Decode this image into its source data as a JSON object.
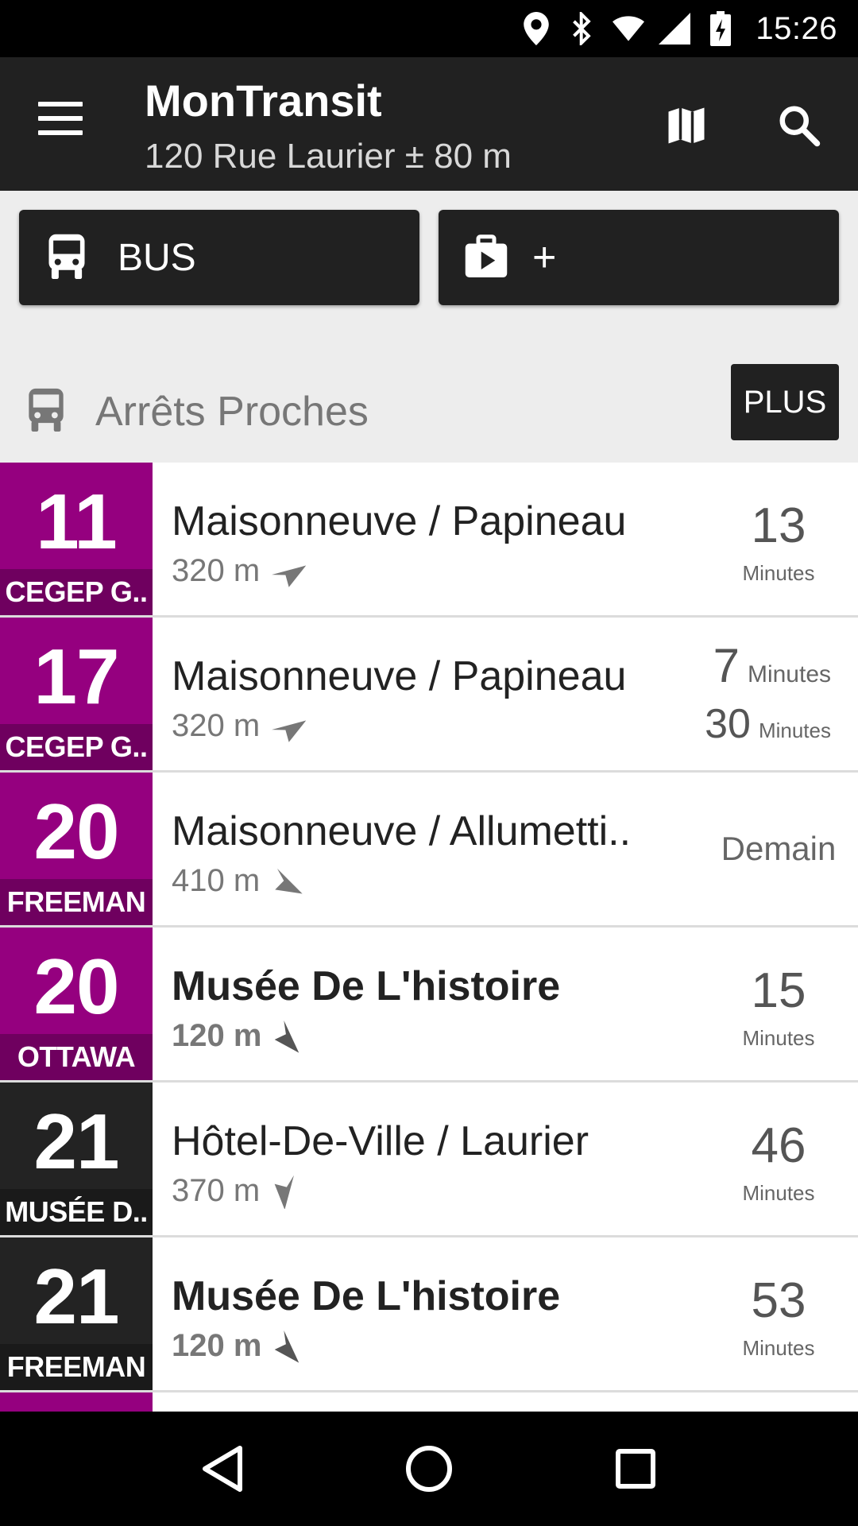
{
  "status_bar": {
    "time": "15:26"
  },
  "app_bar": {
    "title": "MonTransit",
    "subtitle": "120 Rue Laurier ± 80 m"
  },
  "actions": {
    "bus_label": "BUS",
    "add_label": "+"
  },
  "nearby": {
    "title": "Arrêts Proches",
    "more_label": "PLUS"
  },
  "colors": {
    "route_purple": "#95007f",
    "route_dark": "#232323",
    "app_bar": "#212121"
  },
  "stops": [
    {
      "route": "11",
      "headsign": "CEGEP G..",
      "color": "#95007f",
      "name": "Maisonneuve / Papineau",
      "distance": "320 m",
      "eta_value": "13",
      "eta_unit": "Minutes"
    },
    {
      "route": "17",
      "headsign": "CEGEP G..",
      "color": "#95007f",
      "name": "Maisonneuve / Papineau",
      "distance": "320 m",
      "eta1_value": "7",
      "eta1_unit": "Minutes",
      "eta2_value": "30",
      "eta2_unit": "Minutes"
    },
    {
      "route": "20",
      "headsign": "FREEMAN",
      "color": "#95007f",
      "name": "Maisonneuve / Allumetti..",
      "distance": "410 m",
      "eta_word": "Demain"
    },
    {
      "route": "20",
      "headsign": "OTTAWA",
      "color": "#95007f",
      "name": "Musée De L'histoire",
      "distance": "120 m",
      "eta_value": "15",
      "eta_unit": "Minutes"
    },
    {
      "route": "21",
      "headsign": "MUSÉE D..",
      "color": "#232323",
      "name": "Hôtel-De-Ville / Laurier",
      "distance": "370 m",
      "eta_value": "46",
      "eta_unit": "Minutes"
    },
    {
      "route": "21",
      "headsign": "FREEMAN",
      "color": "#232323",
      "name": "Musée De L'histoire",
      "distance": "120 m",
      "eta_value": "53",
      "eta_unit": "Minutes"
    }
  ],
  "icons": {
    "menu": "hamburger-icon",
    "map": "map-icon",
    "search": "search-icon",
    "bus": "bus-icon",
    "add": "add-module-icon",
    "compass": "compass-arrow-icon",
    "back": "back-icon",
    "home": "home-icon",
    "recents": "recents-icon"
  }
}
